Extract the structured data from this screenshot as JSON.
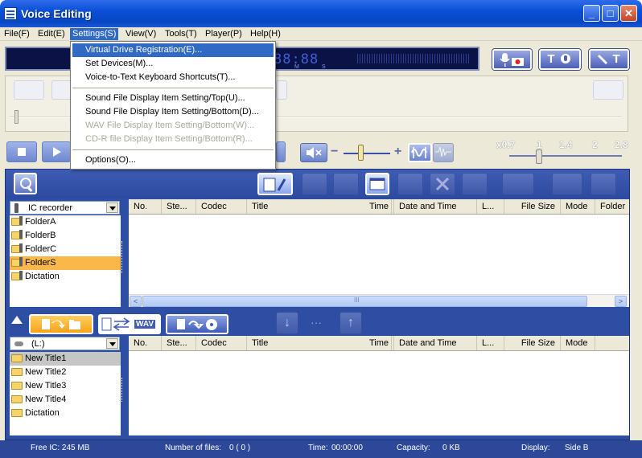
{
  "window": {
    "title": "Voice Editing"
  },
  "menubar": [
    "File(F)",
    "Edit(E)",
    "Settings(S)",
    "View(V)",
    "Tools(T)",
    "Player(P)",
    "Help(H)"
  ],
  "settings_menu": {
    "items": [
      {
        "label": "Virtual Drive Registration(E)...",
        "state": "highlighted"
      },
      {
        "label": "Set Devices(M)...",
        "state": "enabled"
      },
      {
        "label": "Voice-to-Text Keyboard Shortcuts(T)...",
        "state": "enabled"
      },
      {
        "label": "Sound File Display Item Setting/Top(U)...",
        "state": "enabled"
      },
      {
        "label": "Sound File Display Item Setting/Bottom(D)...",
        "state": "enabled"
      },
      {
        "label": "WAV File Display Item Setting/Bottom(W)...",
        "state": "disabled"
      },
      {
        "label": "CD-R file Display Item Setting/Bottom(R)...",
        "state": "disabled"
      },
      {
        "label": "Options(O)...",
        "state": "enabled"
      }
    ]
  },
  "display": {
    "time": "88:88",
    "unit_m": "M",
    "unit_s": "S"
  },
  "right_buttons": {
    "text_button": "T",
    "edit_button": "T"
  },
  "speed": {
    "labels": [
      "x0.7",
      "1",
      "1.4",
      "2",
      "2.8"
    ],
    "value": 1
  },
  "volume": {
    "minus": "−",
    "plus": "+"
  },
  "upper_pane": {
    "device": "IC recorder",
    "folders": [
      {
        "name": "FolderA",
        "selected": false
      },
      {
        "name": "FolderB",
        "selected": false
      },
      {
        "name": "FolderC",
        "selected": false
      },
      {
        "name": "FolderS",
        "selected": true
      },
      {
        "name": "Dictation",
        "selected": false
      }
    ],
    "columns": [
      "No.",
      "Ste...",
      "Codec",
      "Title",
      "Time",
      "Date and Time",
      "L...",
      "File Size",
      "Mode",
      "Folder"
    ],
    "scroll_grip": "III"
  },
  "transfer": {
    "wav_label": "WAV",
    "dots": "···"
  },
  "lower_pane": {
    "drive": "(L:)",
    "folders": [
      {
        "name": "New Title1",
        "selected": true
      },
      {
        "name": "New Title2",
        "selected": false
      },
      {
        "name": "New Title3",
        "selected": false
      },
      {
        "name": "New Title4",
        "selected": false
      },
      {
        "name": "Dictation",
        "selected": false
      }
    ],
    "columns": [
      "No.",
      "Ste...",
      "Codec",
      "Title",
      "Time",
      "Date and Time",
      "L...",
      "File Size",
      "Mode"
    ]
  },
  "status": {
    "free": "Free IC: 245 MB",
    "files_label": "Number of files:",
    "files_value": "0 ( 0 )",
    "time_label": "Time:",
    "time_value": "00:00:00",
    "capacity_label": "Capacity:",
    "capacity_value": "0 KB",
    "display_label": "Display:",
    "display_value": "Side B"
  }
}
